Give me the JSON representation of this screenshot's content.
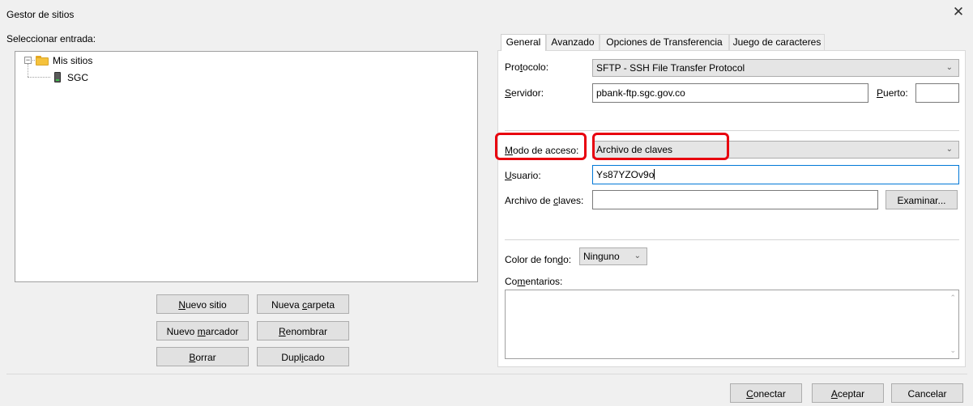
{
  "window": {
    "title": "Gestor de sitios",
    "close_glyph": "✕"
  },
  "left": {
    "select_label": "Seleccionar entrada:",
    "tree": {
      "root": {
        "label": "Mis sitios",
        "expander": "−",
        "icon": "folder-icon"
      },
      "child": {
        "label": "SGC",
        "icon": "server-icon"
      }
    },
    "buttons": {
      "new_site": "Nuevo sitio",
      "new_folder": "Nueva carpeta",
      "new_bookmark": "Nuevo marcador",
      "rename": "Renombrar",
      "delete": "Borrar",
      "duplicate": "Duplicado"
    }
  },
  "tabs": [
    "General",
    "Avanzado",
    "Opciones de Transferencia",
    "Juego de caracteres"
  ],
  "general": {
    "protocol_label": "Protocolo:",
    "protocol_value": "SFTP - SSH File Transfer Protocol",
    "server_label": "Servidor:",
    "server_value": "pbank-ftp.sgc.gov.co",
    "port_label": "Puerto:",
    "port_value": "",
    "logon_label": "Modo de acceso:",
    "logon_value": "Archivo de claves",
    "user_label": "Usuario:",
    "user_value": "Ys87YZOv9o",
    "keyfile_label": "Archivo de claves:",
    "keyfile_value": "",
    "browse_button": "Examinar...",
    "bgcolor_label": "Color de fondo:",
    "bgcolor_value": "Ninguno",
    "comments_label": "Comentarios:",
    "comments_value": ""
  },
  "footer": {
    "connect": "Conectar",
    "ok": "Aceptar",
    "cancel": "Cancelar"
  },
  "colors": {
    "highlight_red": "#e8000e",
    "focus_blue": "#0078d7"
  }
}
